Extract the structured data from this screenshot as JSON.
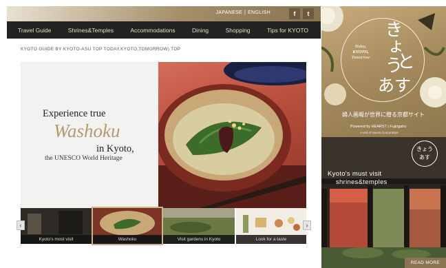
{
  "header": {
    "lang_japanese": "JAPANESE",
    "lang_english": "ENGLISH",
    "facebook_icon_glyph": "f",
    "twitter_icon_glyph": "t"
  },
  "nav": {
    "items": [
      {
        "label": "Travel Guide"
      },
      {
        "label": "Shrines&Temples"
      },
      {
        "label": "Accommodations"
      },
      {
        "label": "Dining"
      },
      {
        "label": "Shopping"
      },
      {
        "label": "Tips for KYOTO"
      }
    ]
  },
  "breadcrumb": "KYOTO GUIDE BY KYOTO-ASU TOP TODAY,KYOTO,TOMORROW) TOP",
  "hero": {
    "line1": "Experience true",
    "line2": "Washoku",
    "line3": "in Kyoto,",
    "line4": "the UNESCO World Heritage"
  },
  "carousel": {
    "items": [
      {
        "caption": "Kyoto's most visit"
      },
      {
        "caption": "Washoku"
      },
      {
        "caption": "Visit gardens in Kyoto"
      },
      {
        "caption": "Look for a taste"
      }
    ],
    "prev_glyph": "‹",
    "next_glyph": "›"
  },
  "banner_top": {
    "small_line1": "Today,",
    "small_line2": "KYOTO,",
    "small_line3": "Tomorrow",
    "kana1": "きょう",
    "kana2": "と",
    "kana3": "あす",
    "subtitle": "婦人画報が世界に贈る京都サイト",
    "powered": "Powered by HEARST | Fujingaho",
    "corp": "A unit of Hearst Corporation"
  },
  "banner_bottom": {
    "title_line1": "Kyoto's must visit",
    "title_line2": "shrines&temples",
    "logo_line1": "きょう",
    "logo_line2": "あす",
    "read_more": "READ MORE"
  },
  "colors": {
    "nav_bg": "#222222",
    "accent_gold": "#b29b6d",
    "hero_red": "#b9503d"
  }
}
